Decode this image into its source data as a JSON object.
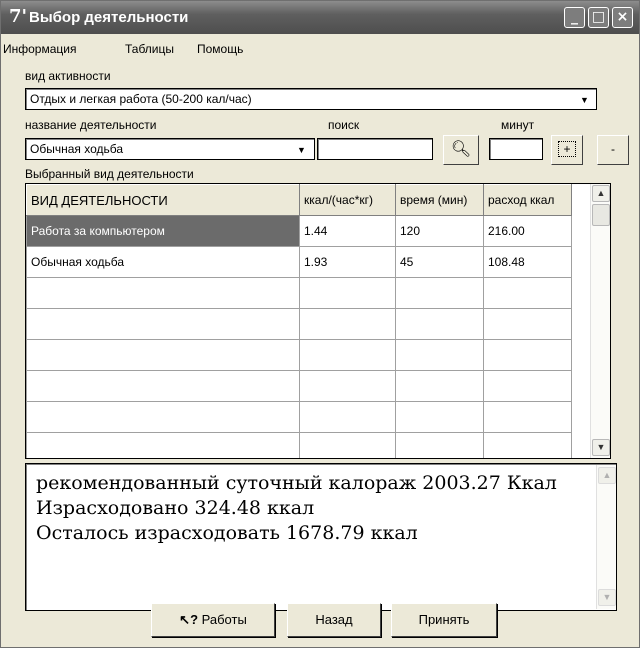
{
  "window": {
    "title": "Выбор деятельности",
    "app_icon": "7'",
    "controls": {
      "minimize": "_",
      "maximize": "□",
      "close": "×"
    }
  },
  "menu": [
    "Информация",
    "Таблицы",
    "Помощь"
  ],
  "activity_type": {
    "label": "вид активности",
    "value": "Отдых и легкая работа (50-200 кал/час)"
  },
  "activity_name": {
    "label": "название деятельности",
    "value": "Обычная ходьба"
  },
  "search": {
    "label": "поиск",
    "value": ""
  },
  "minutes": {
    "label": "минут",
    "value": ""
  },
  "buttons": {
    "add": "+",
    "remove": "-"
  },
  "selected_label": "Выбранный вид деятельности",
  "table": {
    "columns": [
      "ВИД ДЕЯТЕЛЬНОСТИ",
      "ккал/(час*кг)",
      "время (мин)",
      "расход ккал"
    ],
    "rows": [
      [
        "Работа за компьютером",
        "1.44",
        "120",
        "216.00"
      ],
      [
        "Обычная ходьба",
        "1.93",
        "45",
        "108.48"
      ],
      [
        "",
        "",
        "",
        ""
      ],
      [
        "",
        "",
        "",
        ""
      ],
      [
        "",
        "",
        "",
        ""
      ],
      [
        "",
        "",
        "",
        ""
      ],
      [
        "",
        "",
        "",
        ""
      ],
      [
        "",
        "",
        "",
        ""
      ]
    ]
  },
  "summary": [
    "рекомендованный суточный калораж 2003.27 Ккал",
    "Израсходовано 324.48 ккал",
    "Осталось израсходовать 1678.79 ккал"
  ],
  "bottom_buttons": {
    "works": "Работы",
    "back": "Назад",
    "accept": "Принять"
  }
}
